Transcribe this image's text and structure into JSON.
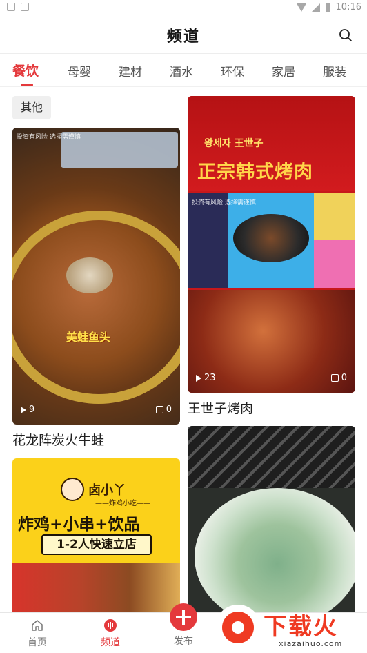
{
  "status_bar": {
    "time": "10:16",
    "icons": [
      "notification-icon",
      "notification-icon-2",
      "wifi-icon",
      "signal-icon",
      "battery-icon"
    ]
  },
  "header": {
    "title": "频道",
    "search_icon": "search-icon"
  },
  "tabs": [
    {
      "label": "餐饮",
      "active": true
    },
    {
      "label": "母婴",
      "active": false
    },
    {
      "label": "建材",
      "active": false
    },
    {
      "label": "酒水",
      "active": false
    },
    {
      "label": "环保",
      "active": false
    },
    {
      "label": "家居",
      "active": false
    },
    {
      "label": "服装",
      "active": false
    }
  ],
  "filter_chip": "其他",
  "cards": [
    {
      "title": "花龙阵炭火牛蛙",
      "plays": "9",
      "likes": "0",
      "overlay": "投资有风险 选择需谨慎",
      "image_text": "美蛙鱼头"
    },
    {
      "title": "王世子烤肉",
      "plays": "23",
      "likes": "0",
      "brand": "왕세자 王世子",
      "headline": "正宗韩式烤肉",
      "overlay": "投资有风险 选择需谨慎"
    },
    {
      "logo": "卤小丫",
      "logo_sub": "——炸鸡小吃——",
      "headline": "炸鸡+小串+饮品",
      "box_text": "1-2人快速立店"
    },
    {
      "title": ""
    }
  ],
  "bottom_nav": [
    {
      "label": "首页",
      "icon": "home-icon",
      "active": false
    },
    {
      "label": "频道",
      "icon": "channel-icon",
      "active": true
    },
    {
      "label": "发布",
      "icon": "publish-icon",
      "active": false
    }
  ],
  "watermark": {
    "text": "下载火",
    "sub": "xiazaihuo.com"
  },
  "colors": {
    "accent": "#e4393c",
    "text": "#222222",
    "chip_bg": "#efefef"
  }
}
